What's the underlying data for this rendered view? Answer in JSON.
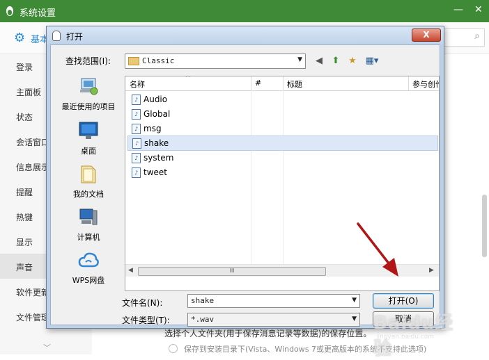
{
  "background_window": {
    "title": "系统设置",
    "first_tab": "基本",
    "sidebar": [
      {
        "label": "登录"
      },
      {
        "label": "主面板"
      },
      {
        "label": "状态"
      },
      {
        "label": "会话窗口"
      },
      {
        "label": "信息展示"
      },
      {
        "label": "提醒"
      },
      {
        "label": "热键"
      },
      {
        "label": "显示"
      },
      {
        "label": "声音",
        "selected": true
      },
      {
        "label": "软件更新"
      },
      {
        "label": "文件管理"
      }
    ],
    "bottom_text": "选择个人文件夹(用于保存消息记录等数据)的保存位置。",
    "radio_text": "保存到安装目录下(Vista、Windows 7或更高版本的系统不支持此选项)"
  },
  "dialog": {
    "title": "打开",
    "close_label": "X",
    "look_in_label": "查找范围(I):",
    "look_in_value": "Classic",
    "places": [
      {
        "label": "最近使用的项目",
        "icon": "recent-items-icon"
      },
      {
        "label": "桌面",
        "icon": "desktop-icon"
      },
      {
        "label": "我的文档",
        "icon": "my-documents-icon"
      },
      {
        "label": "计算机",
        "icon": "computer-icon"
      },
      {
        "label": "WPS网盘",
        "icon": "wps-cloud-icon"
      }
    ],
    "columns": [
      "名称",
      "#",
      "标题",
      "参与创作"
    ],
    "files": [
      {
        "name": "Audio"
      },
      {
        "name": "Global"
      },
      {
        "name": "msg"
      },
      {
        "name": "shake",
        "selected": true
      },
      {
        "name": "system"
      },
      {
        "name": "tweet"
      }
    ],
    "scroll_thumb": "III",
    "filename_label": "文件名(N):",
    "filename_value": "shake",
    "filetype_label": "文件类型(T):",
    "filetype_value": "*.wav",
    "open_button": "打开(O)",
    "cancel_button": "取消"
  },
  "watermark": {
    "main": "Baidu经验",
    "sub": "jingyan.baidu.com"
  },
  "colors": {
    "titlebar": "#3f8a37",
    "selection": "#dce8f7",
    "accent": "#2a8bd8",
    "annotation": "#b01616"
  }
}
